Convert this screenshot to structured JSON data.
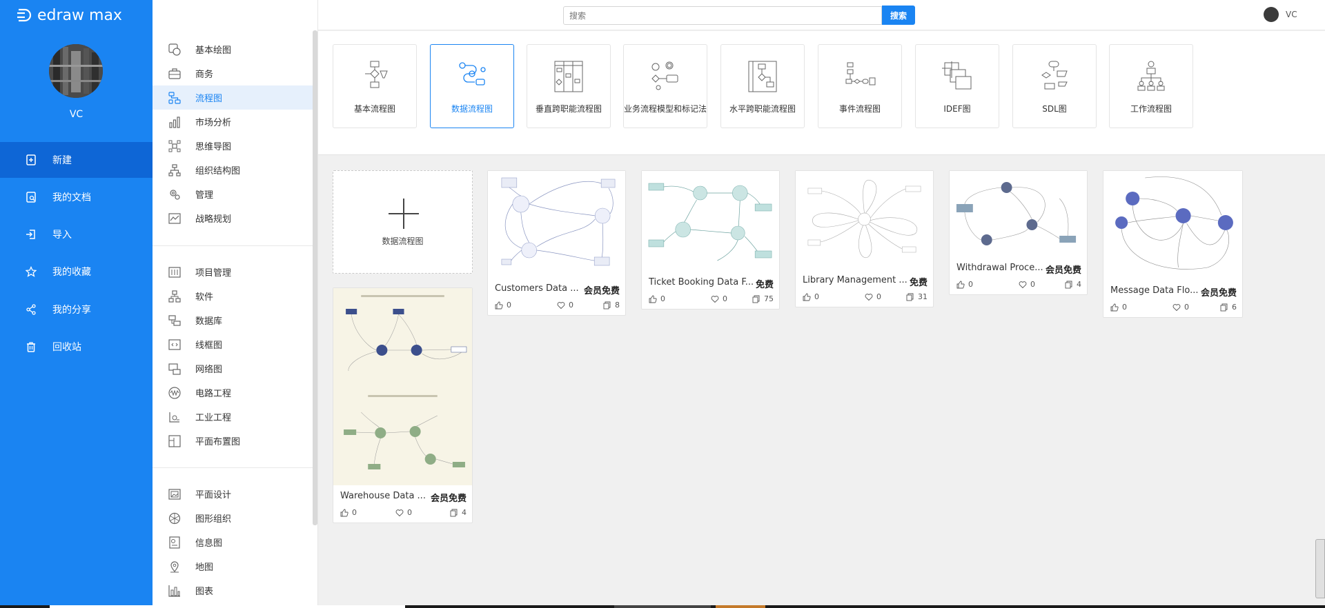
{
  "app": {
    "logo_text": "edraw max",
    "username": "VC"
  },
  "leftnav": {
    "items": [
      {
        "label": "新建",
        "icon": "new-file-icon"
      },
      {
        "label": "我的文档",
        "icon": "document-icon"
      },
      {
        "label": "导入",
        "icon": "import-icon"
      },
      {
        "label": "我的收藏",
        "icon": "star-icon"
      },
      {
        "label": "我的分享",
        "icon": "share-icon"
      },
      {
        "label": "回收站",
        "icon": "trash-icon"
      }
    ]
  },
  "categories": {
    "group1": [
      "基本绘图",
      "商务",
      "流程图",
      "市场分析",
      "思维导图",
      "组织结构图",
      "管理",
      "战略规划"
    ],
    "group2": [
      "项目管理",
      "软件",
      "数据库",
      "线框图",
      "网络图",
      "电路工程",
      "工业工程",
      "平面布置图"
    ],
    "group3": [
      "平面设计",
      "图形组织",
      "信息图",
      "地图",
      "图表"
    ],
    "active": "流程图"
  },
  "search": {
    "placeholder": "搜索",
    "button": "搜索"
  },
  "types": [
    "基本流程图",
    "数据流程图",
    "垂直跨职能流程图",
    "业务流程模型和标记法",
    "水平跨职能流程图",
    "事件流程图",
    "IDEF图",
    "SDL图",
    "工作流程图"
  ],
  "blank": {
    "label": "数据流程图"
  },
  "templates": [
    {
      "title": "Customers Data ...",
      "badge": "会员免费",
      "likes": "0",
      "favs": "0",
      "copies": "8"
    },
    {
      "title": "Ticket Booking Data F...",
      "badge": "免费",
      "likes": "0",
      "favs": "0",
      "copies": "75"
    },
    {
      "title": "Library Management ...",
      "badge": "免费",
      "likes": "0",
      "favs": "0",
      "copies": "31"
    },
    {
      "title": "Withdrawal Proce...",
      "badge": "会员免费",
      "likes": "0",
      "favs": "0",
      "copies": "4"
    },
    {
      "title": "Message Data Flo...",
      "badge": "会员免费",
      "likes": "0",
      "favs": "0",
      "copies": "6"
    },
    {
      "title": "Warehouse Data ...",
      "badge": "会员免费",
      "likes": "0",
      "favs": "0",
      "copies": "4"
    }
  ],
  "colors": {
    "primary": "#1a84f2",
    "active_nav": "#0e66d6"
  }
}
